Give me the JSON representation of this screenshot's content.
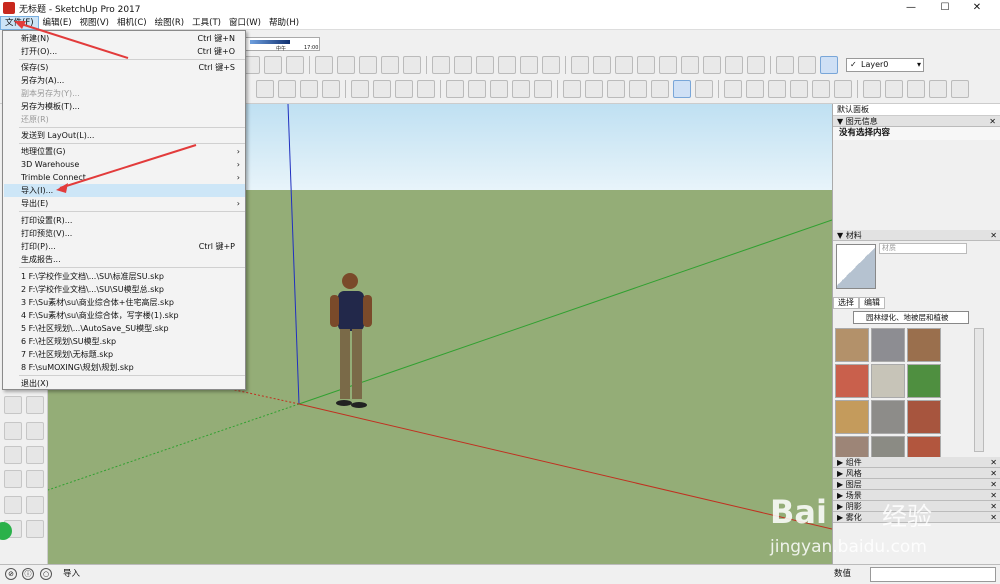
{
  "window": {
    "title": "无标题 - SketchUp Pro 2017",
    "minimize": "—",
    "maximize": "☐",
    "close": "✕"
  },
  "menubar": [
    "文件(F)",
    "编辑(E)",
    "视图(V)",
    "相机(C)",
    "绘图(R)",
    "工具(T)",
    "窗口(W)",
    "帮助(H)"
  ],
  "file_menu": {
    "new": {
      "label": "新建(N)",
      "shortcut": "Ctrl 键+N"
    },
    "open": {
      "label": "打开(O)...",
      "shortcut": "Ctrl 键+O"
    },
    "save": {
      "label": "保存(S)",
      "shortcut": "Ctrl 键+S"
    },
    "save_as": "另存为(A)...",
    "save_copy_as": "副本另存为(Y)...",
    "save_as_template": "另存为模板(T)...",
    "revert": "还原(R)",
    "send_to_layout": "发送到 LayOut(L)...",
    "geo_location": "地理位置(G)",
    "warehouse": "3D Warehouse",
    "trimble_connect": "Trimble Connect",
    "import": "导入(I)...",
    "export": "导出(E)",
    "print_setup": "打印设置(R)...",
    "print_preview": "打印预览(V)...",
    "print": {
      "label": "打印(P)...",
      "shortcut": "Ctrl 键+P"
    },
    "generate_report": "生成报告...",
    "recent": [
      "1 F:\\学校作业文档\\...\\SU\\标准层SU.skp",
      "2 F:\\学校作业文档\\...\\SU\\SU模型总.skp",
      "3 F:\\Su素材\\su\\商业综合体+住宅高层.skp",
      "4 F:\\Su素材\\su\\商业综合体，写字楼(1).skp",
      "5 F:\\社区规划\\...\\AutoSave_SU模型.skp",
      "6 F:\\社区规划\\SU模型.skp",
      "7 F:\\社区规划\\无标题.skp",
      "8 F:\\suMOXING\\规划\\规划.skp"
    ],
    "exit": "退出(X)"
  },
  "shadow_slider": {
    "left": "中午",
    "right": "17:00"
  },
  "layer_select": "Layer0",
  "right_panel": {
    "title": "默认面板",
    "entity_info": {
      "header": "图元信息",
      "content": "没有选择内容"
    },
    "materials": {
      "header": "材料",
      "name_placeholder": "材质",
      "tab_select": "选择",
      "tab_edit": "编辑",
      "library": "园林绿化、地被层和植被"
    },
    "collapsed_sections": [
      "组件",
      "风格",
      "图层",
      "场景",
      "阴影",
      "雾化"
    ]
  },
  "status": {
    "text": "导入",
    "measure_label": "数值"
  },
  "watermark": {
    "brand": "Bai",
    "sub": "jingyan.baidu.com",
    "cn": "经验"
  },
  "colors": {
    "highlight": "#cde6f7",
    "ground": "#94ad77",
    "sky": "#bfe0f2",
    "annotation_arrow": "#e23b3b"
  }
}
